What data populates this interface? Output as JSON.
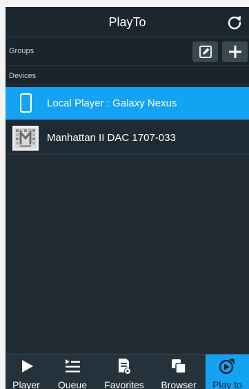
{
  "header": {
    "title": "PlayTo"
  },
  "groups": {
    "label": "Groups"
  },
  "devices": {
    "label": "Devices",
    "items": [
      {
        "label": "Local Player : Galaxy Nexus",
        "icon": "phone-icon",
        "selected": true
      },
      {
        "label": "Manhattan II DAC 1707-033",
        "icon": "dac-device-icon",
        "selected": false
      }
    ]
  },
  "nav": {
    "items": [
      {
        "label": "Player",
        "icon": "play-icon"
      },
      {
        "label": "Queue",
        "icon": "queue-icon"
      },
      {
        "label": "Favorites",
        "icon": "favorites-icon"
      },
      {
        "label": "Browser",
        "icon": "browser-icon"
      },
      {
        "label": "Play to",
        "icon": "play-to-icon",
        "active": true
      }
    ]
  },
  "colors": {
    "accent": "#14a3f2",
    "background": "#1e2a33",
    "nav_background": "#26323b"
  }
}
